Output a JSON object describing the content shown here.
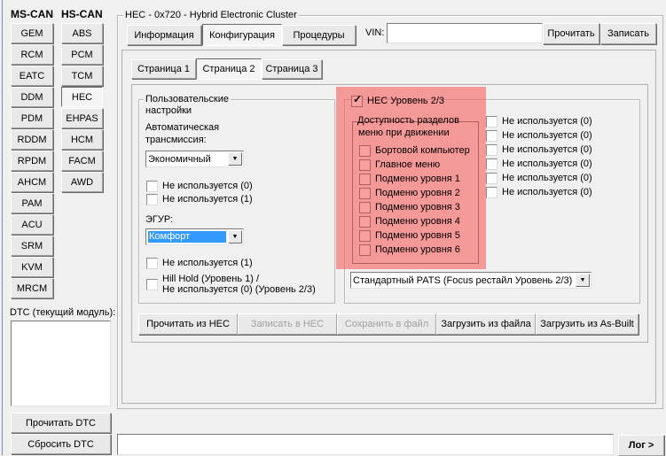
{
  "sidebar": {
    "ms_can_header": "MS-CAN",
    "hs_can_header": "HS-CAN",
    "ms_can_modules": [
      "GEM",
      "RCM",
      "EATC",
      "DDM",
      "PDM",
      "RDDM",
      "RPDM",
      "AHCM",
      "PAM",
      "ACU",
      "SRM",
      "KVM",
      "MRCM"
    ],
    "hs_can_modules": [
      "ABS",
      "PCM",
      "TCM",
      "HEC",
      "EHPAS",
      "HCM",
      "FACM",
      "AWD"
    ],
    "selected_module": "HEC",
    "dtc_label": "DTC (текущий модуль):",
    "read_dtc": "Прочитать DTC",
    "clear_dtc": "Сбросить DTC"
  },
  "module": {
    "title": "HEC - 0x720 - Hybrid Electronic Cluster",
    "tabs": [
      "Информация",
      "Конфигурация",
      "Процедуры"
    ],
    "active_tab": "Конфигурация",
    "vin_label": "VIN:",
    "vin_value": "",
    "vin_read": "Прочитать",
    "vin_write": "Записать"
  },
  "pages": {
    "tabs": [
      "Страница 1",
      "Страница 2",
      "Страница 3"
    ],
    "active": "Страница 2"
  },
  "user_settings": {
    "title": "Пользовательские настройки",
    "title_line1": "Пользовательские",
    "title_line2": "настройки",
    "at_label_line1": "Автоматическая",
    "at_label_line2": "трансмиссия:",
    "at_value": "Экономичный",
    "checks1": [
      {
        "label": "Не используется (0)",
        "checked": false
      },
      {
        "label": "Не используется (1)",
        "checked": false
      }
    ],
    "egur_label": "ЭГУР:",
    "egur_value": "Комфорт",
    "check_unused1": {
      "label": "Не используется (1)",
      "checked": false
    },
    "check_hillhold": {
      "line1": "Hill Hold (Уровень 1) /",
      "line2": "Не используется (0) (Уровень 2/3)",
      "checked": false
    }
  },
  "hec_level": {
    "title": "HEC Уровень 2/3",
    "checked": true,
    "menu_group_line1": "Доступность разделов",
    "menu_group_line2": "меню при движении",
    "menu_items": [
      {
        "label": "Бортовой компьютер",
        "checked": false
      },
      {
        "label": "Главное меню",
        "checked": false
      },
      {
        "label": "Подменю уровня 1",
        "checked": false
      },
      {
        "label": "Подменю уровня 2",
        "checked": false
      },
      {
        "label": "Подменю уровня 3",
        "checked": false
      },
      {
        "label": "Подменю уровня 4",
        "checked": false
      },
      {
        "label": "Подменю уровня 5",
        "checked": false
      },
      {
        "label": "Подменю уровня 6",
        "checked": false
      }
    ],
    "unused_items": [
      {
        "label": "Не используется (0)",
        "checked": false
      },
      {
        "label": "Не используется (0)",
        "checked": false
      },
      {
        "label": "Не используется (0)",
        "checked": false
      },
      {
        "label": "Не используется (0)",
        "checked": false
      },
      {
        "label": "Не используется (0)",
        "checked": false
      },
      {
        "label": "Не используется (0)",
        "checked": false
      }
    ],
    "pats_value": "Стандартный PATS (Focus рестайл Уровень 2/3)",
    "highlight_color": "#f87171"
  },
  "actions": {
    "read_from_hec": "Прочитать из HEC",
    "write_to_hec": "Записать в HEC",
    "save_to_file": "Сохранить в файл",
    "load_from_file": "Загрузить из файла",
    "load_from_asbuilt": "Загрузить из As-Built"
  },
  "footer": {
    "log_value": "",
    "log_button": "Лог >"
  }
}
